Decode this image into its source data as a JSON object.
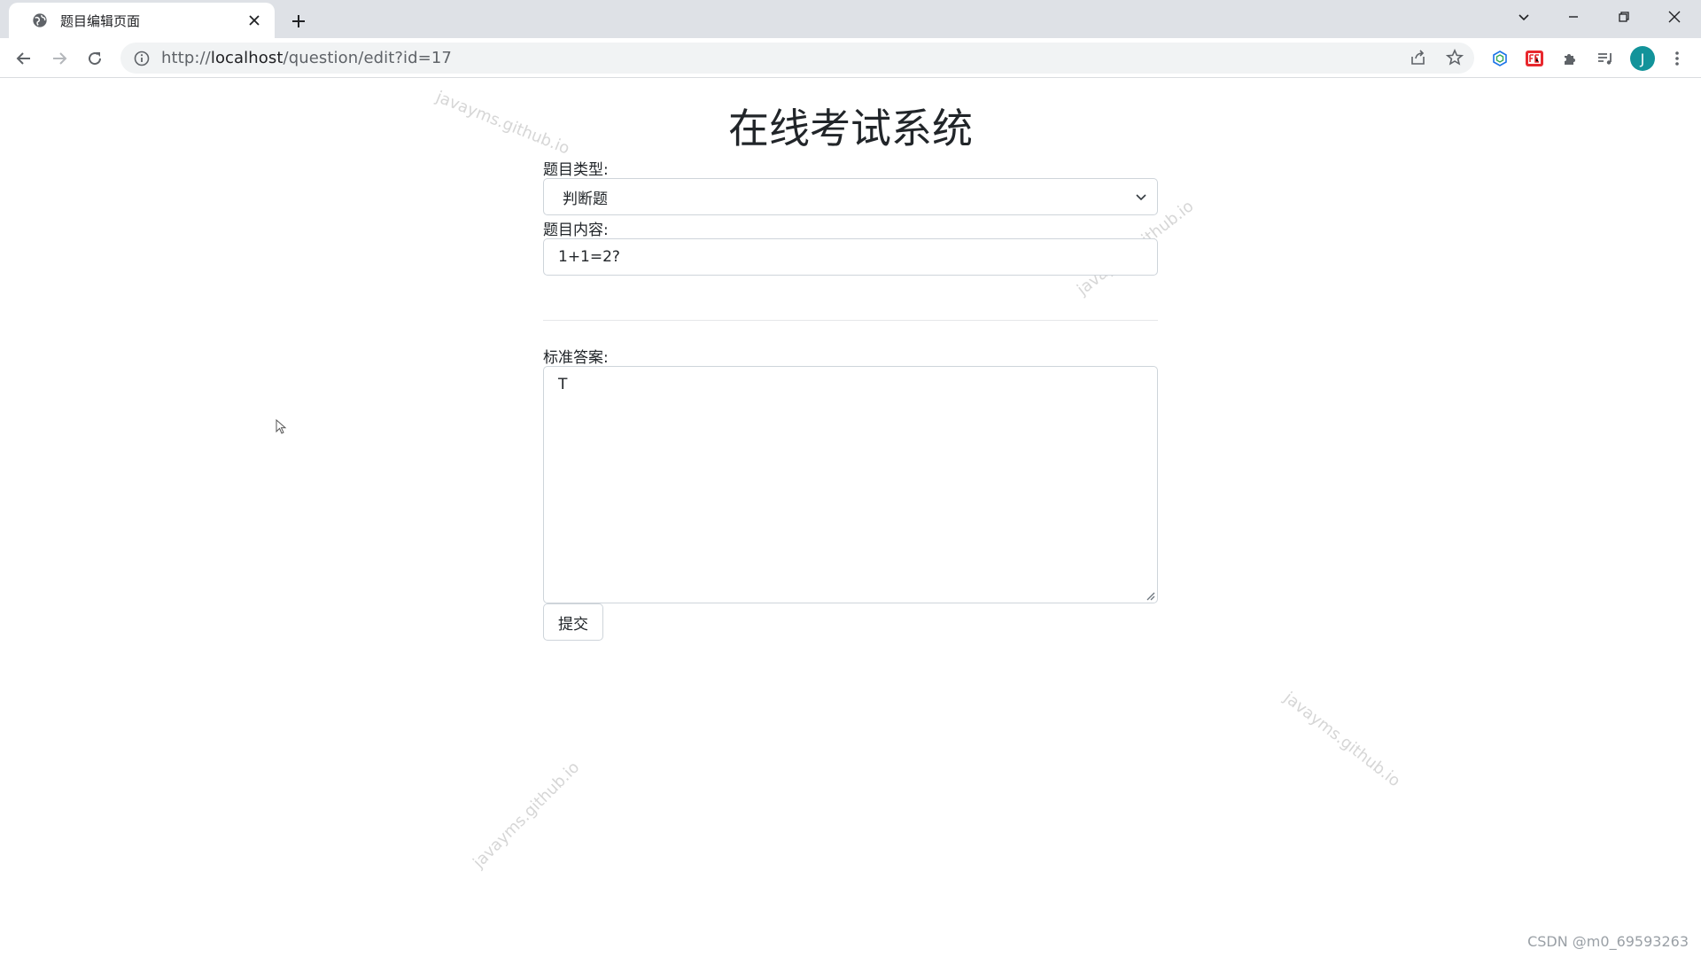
{
  "browser": {
    "tab_title": "题目编辑页面",
    "url_prefix": "http://",
    "url_host": "localhost",
    "url_path": "/question/edit?id=17",
    "profile_initial": "J",
    "accent": "#12939a"
  },
  "page": {
    "heading": "在线考试系统",
    "type_label": "题目类型:",
    "type_value": "判断题",
    "content_label": "题目内容:",
    "content_value": "1+1=2?",
    "answer_label": "标准答案:",
    "answer_value": "T",
    "submit_label": "提交"
  },
  "watermark": {
    "text": "javayms.github.io"
  },
  "footer": {
    "credit": "CSDN @m0_69593263"
  }
}
